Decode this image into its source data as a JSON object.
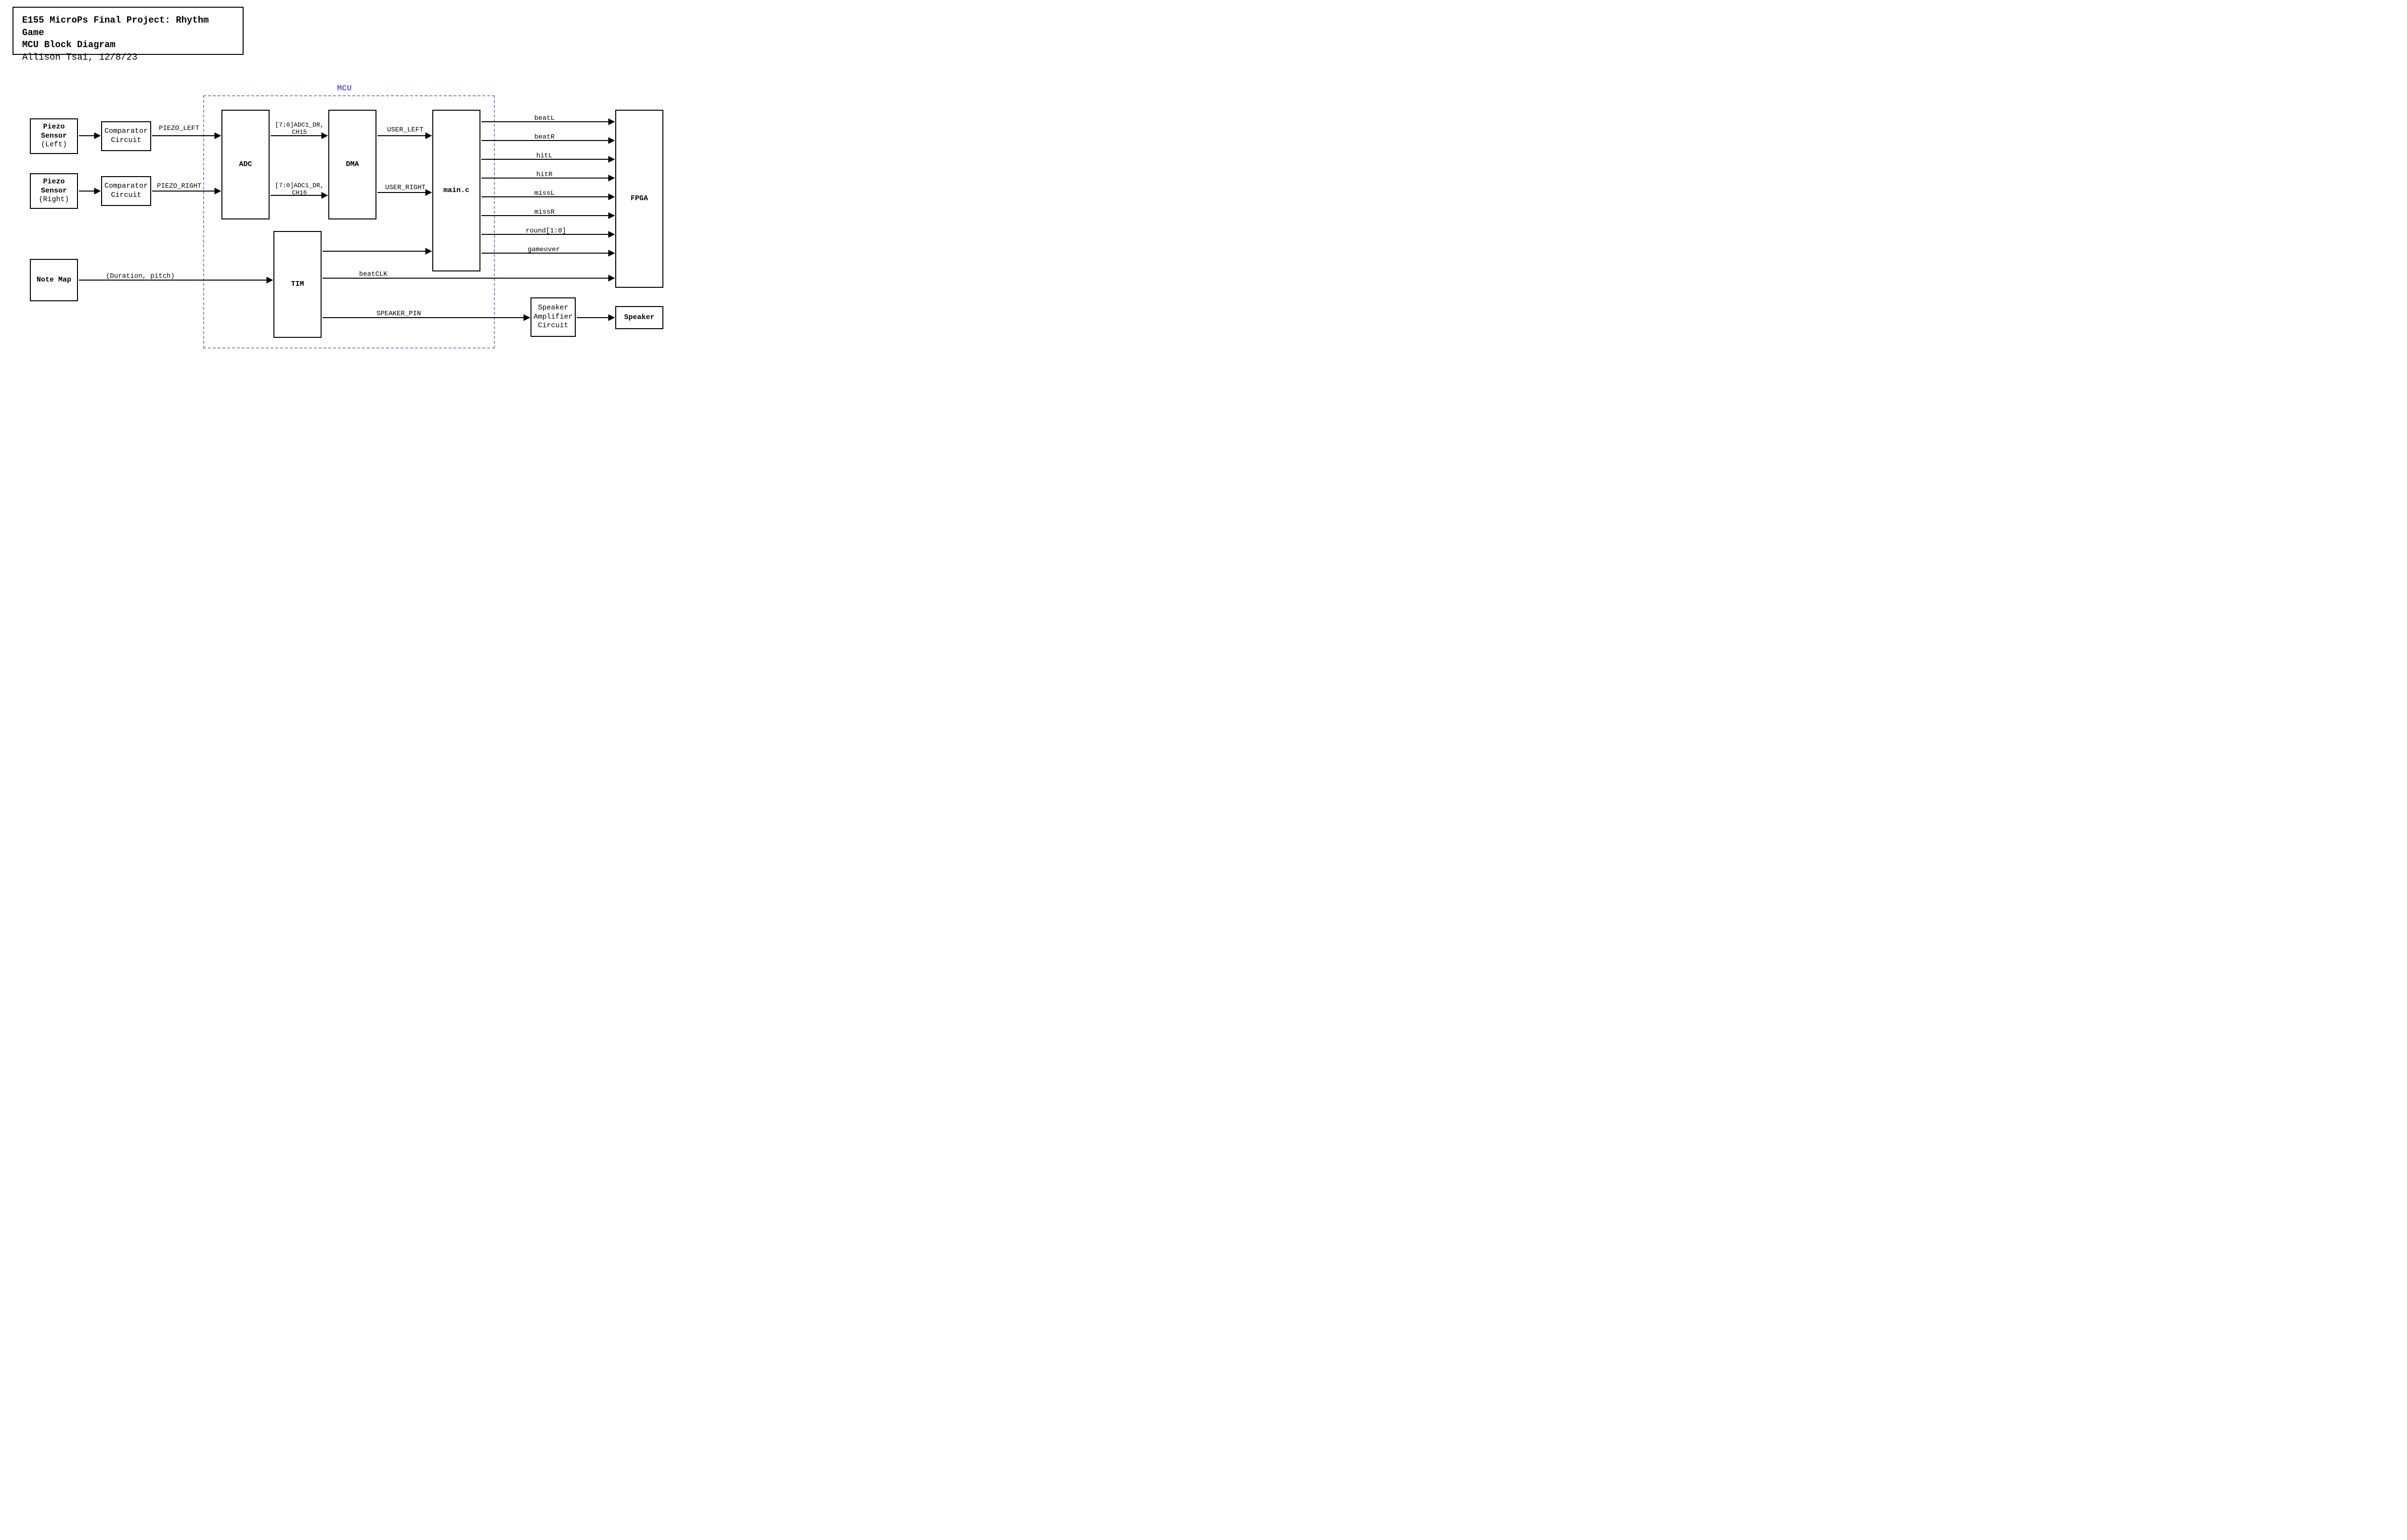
{
  "title": {
    "line1": "E155 MicroPs Final Project: Rhythm Game",
    "line2": "MCU Block Diagram",
    "line3": "Allison Tsai, 12/8/23"
  },
  "mcu_label": "MCU",
  "blocks": {
    "piezo_left": "Piezo\nSensor\n(Left)",
    "piezo_left_bold": "Piezo\nSensor",
    "piezo_left_plain": "(Left)",
    "piezo_right_bold": "Piezo\nSensor",
    "piezo_right_plain": "(Right)",
    "comp1": "Comparator\nCircuit",
    "comp2": "Comparator\nCircuit",
    "notemap": "Note Map",
    "adc": "ADC",
    "dma": "DMA",
    "tim": "TIM",
    "main": "main.c",
    "fpga": "FPGA",
    "spkamp": "Speaker\nAmplifier\nCircuit",
    "speaker": "Speaker"
  },
  "signals": {
    "piezo_left": "PIEZO_LEFT",
    "piezo_right": "PIEZO_RIGHT",
    "adc_dr15": "[7:0]ADC1_DR,\nCH15",
    "adc_dr16": "[7:0]ADC1_DR,\nCH16",
    "user_left": "USER_LEFT",
    "user_right": "USER_RIGHT",
    "notemap": "(Duration, pitch)",
    "beatclk": "beatCLK",
    "speaker_pin": "SPEAKER_PIN",
    "out": {
      "beatL": "beatL",
      "beatR": "beatR",
      "hitL": "hitL",
      "hitR": "hitR",
      "missL": "missL",
      "missR": "missR",
      "round": "round[1:0]",
      "gameover": "gameover"
    }
  }
}
